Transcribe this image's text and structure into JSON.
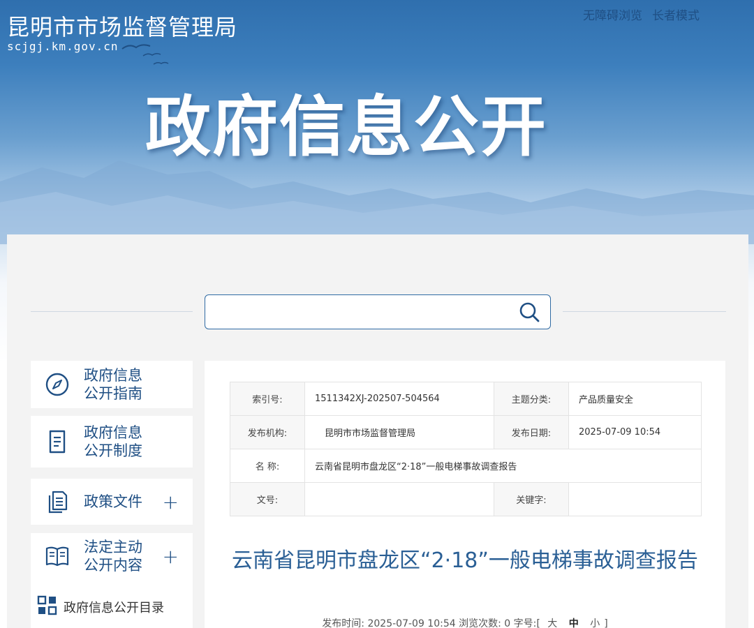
{
  "header": {
    "site_name": "昆明市市场监督管理局",
    "site_domain": "scjgj.km.gov.cn",
    "links": [
      "无障碍浏览",
      "长者模式"
    ],
    "hero_title": "政府信息公开"
  },
  "search": {
    "placeholder": "",
    "icon": "search-icon"
  },
  "sidebar": {
    "items": [
      {
        "label": "政府信息公开指南",
        "icon": "compass-icon",
        "expandable": false
      },
      {
        "label": "政府信息公开制度",
        "icon": "document-icon",
        "expandable": false
      },
      {
        "label": "政策文件",
        "icon": "files-icon",
        "expandable": true
      },
      {
        "label": "法定主动公开内容",
        "icon": "book-icon",
        "expandable": true
      }
    ],
    "catalog": {
      "label": "政府信息公开目录",
      "icon": "grid-icon"
    }
  },
  "meta_table": {
    "index_label": "索引号:",
    "index_value": "1511342XJ-202507-504564",
    "topic_label": "主题分类:",
    "topic_value": "产品质量安全",
    "issuer_label": "发布机构:",
    "issuer_value": "昆明市市场监督管理局",
    "date_label": "发布日期:",
    "date_value": "2025-07-09 10:54",
    "name_label": "名 称:",
    "name_value": "云南省昆明市盘龙区“2·18”一般电梯事故调查报告",
    "docno_label": "文号:",
    "docno_value": "",
    "keyword_label": "关键字:",
    "keyword_value": ""
  },
  "article": {
    "title": "云南省昆明市盘龙区“2·18”一般电梯事故调查报告",
    "publish_label": "发布时间:",
    "publish_time": "2025-07-09 10:54",
    "views_label": "浏览次数:",
    "views": "0",
    "fontsize_label": "字号:",
    "font_sizes": [
      "大",
      "中",
      "小"
    ]
  },
  "colors": {
    "brand_blue": "#1f4f84",
    "title_blue": "#2a5f95",
    "banner_top": "#2f6fae"
  }
}
